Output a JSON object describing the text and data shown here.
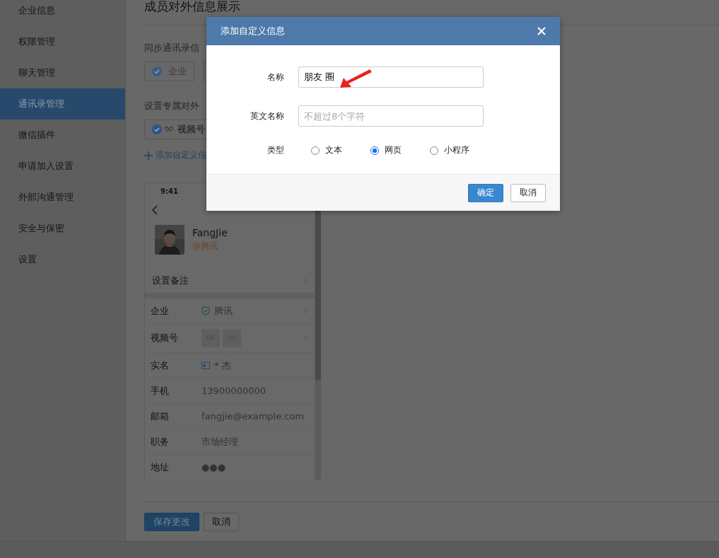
{
  "sidebar": {
    "items": [
      {
        "label": "企业信息",
        "selected": false
      },
      {
        "label": "权限管理",
        "selected": false
      },
      {
        "label": "聊天管理",
        "selected": false
      },
      {
        "label": "通讯录管理",
        "selected": true
      },
      {
        "label": "微信插件",
        "selected": false
      },
      {
        "label": "申请加入设置",
        "selected": false
      },
      {
        "label": "外部沟通管理",
        "selected": false
      },
      {
        "label": "安全与保密",
        "selected": false
      },
      {
        "label": "设置",
        "selected": false
      }
    ]
  },
  "main": {
    "title": "成员对外信息展示",
    "sync_section": {
      "label": "同步通讯录信",
      "chips": [
        {
          "label": "企业",
          "checked": true
        }
      ]
    },
    "exclusive_section": {
      "label": "设置专属对外",
      "chips": [
        {
          "label": "视频号",
          "checked": true
        }
      ],
      "add_link": "添加自定义信"
    },
    "phone_preview": {
      "time": "9:41",
      "name": "FangJie",
      "company": "@腾讯",
      "remark_label": "设置备注",
      "rows": [
        {
          "kind": "verified",
          "label": "企业",
          "value": "腾讯"
        },
        {
          "kind": "channels",
          "label": "视频号"
        },
        {
          "kind": "realname",
          "label": "实名",
          "value": "* 杰"
        },
        {
          "kind": "text",
          "label": "手机",
          "value": "13900000000"
        },
        {
          "kind": "text",
          "label": "邮箱",
          "value": "fangjie@example.com"
        },
        {
          "kind": "text",
          "label": "职务",
          "value": "市场经理"
        },
        {
          "kind": "text",
          "label": "地址",
          "value": "●●●"
        }
      ]
    },
    "buttons": {
      "save": "保存更改",
      "cancel": "取消"
    }
  },
  "dialog": {
    "title": "添加自定义信息",
    "name": {
      "label": "名称",
      "value": "朋友 圈"
    },
    "english_name": {
      "label": "英文名称",
      "placeholder": "不超过8个字符"
    },
    "type": {
      "label": "类型",
      "options": [
        {
          "label": "文本",
          "selected": false
        },
        {
          "label": "网页",
          "selected": true
        },
        {
          "label": "小程序",
          "selected": false
        }
      ]
    },
    "buttons": {
      "confirm": "确定",
      "cancel": "取消"
    }
  }
}
